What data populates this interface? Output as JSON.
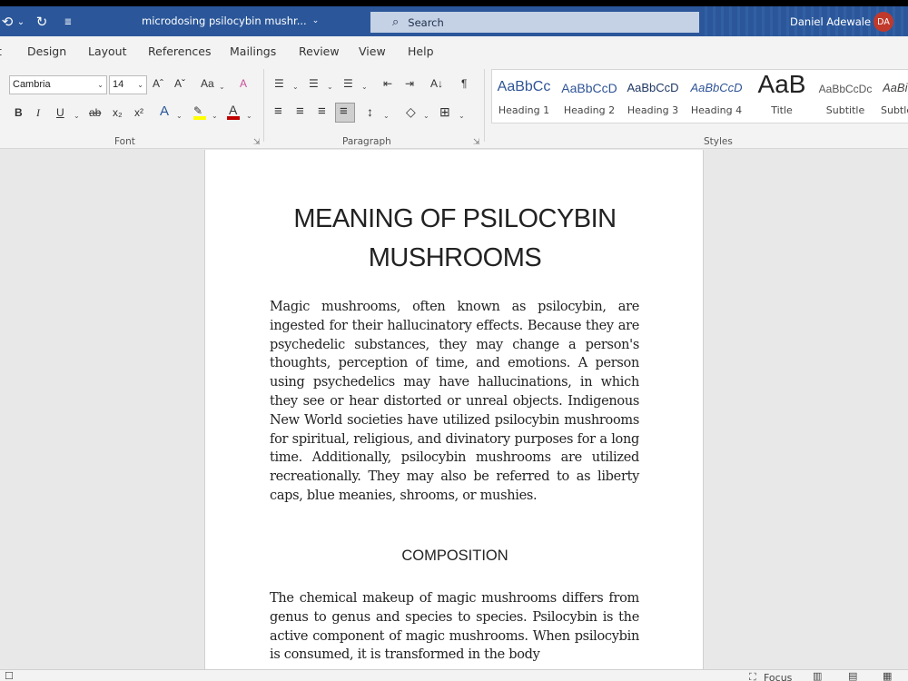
{
  "titlebar": {
    "qat": {
      "undo_icon": "⟲",
      "undo_caret": "⌄",
      "redo_icon": "↻",
      "customize_icon": "≣"
    },
    "doc_name": "microdosing psilocybin mushr...",
    "doc_caret": "⌄",
    "search": {
      "icon": "⌕",
      "label": "Search"
    },
    "user": "Daniel Adewale",
    "initials": "DA",
    "colors": {
      "bar": "#2b579a",
      "avatar": "#c0392b"
    }
  },
  "menu": {
    "partial": "t",
    "tabs": [
      "Design",
      "Layout",
      "References",
      "Mailings",
      "Review",
      "View",
      "Help"
    ]
  },
  "ribbon": {
    "font": {
      "name": "Cambria",
      "size": "14",
      "grow": "Aˆ",
      "shrink": "Aˇ",
      "case": "Aa",
      "clear": "A",
      "bold": "B",
      "italic": "I",
      "underline": "U",
      "strike": "ab",
      "subscript": "x₂",
      "superscript": "x²",
      "effects": "A",
      "highlight": "✎",
      "color": "A",
      "caret": "⌄",
      "label": "Font",
      "launcher": "⇲"
    },
    "paragraph": {
      "bullets": "☰",
      "numbering": "☰",
      "multilevel": "☰",
      "decrease_indent": "⇤",
      "increase_indent": "⇥",
      "sort": "A↓",
      "pilcrow": "¶",
      "align_left": "≡",
      "align_center": "≡",
      "align_right": "≡",
      "justify": "≡",
      "line_spacing": "↕",
      "shading": "◇",
      "borders": "⊞",
      "caret": "⌄",
      "label": "Paragraph",
      "launcher": "⇲"
    },
    "styles": {
      "label": "Styles",
      "items": [
        {
          "sample": "AaBbCc",
          "name": "Heading 1"
        },
        {
          "sample": "AaBbCcD",
          "name": "Heading 2"
        },
        {
          "sample": "AaBbCcD",
          "name": "Heading 3"
        },
        {
          "sample": "AaBbCcD",
          "name": "Heading 4"
        },
        {
          "sample": "AaB",
          "name": "Title"
        },
        {
          "sample": "AaBbCcDc",
          "name": "Subtitle"
        },
        {
          "sample": "AaBi",
          "name": "Subtle"
        }
      ]
    }
  },
  "document": {
    "heading_line1": "MEANING OF PSILOCYBIN",
    "heading_line2": "MUSHROOMS",
    "paragraph1": "Magic mushrooms, often known as psilocybin, are ingested for their hallucinatory effects. Because they are psychedelic substances, they may change a person's thoughts, perception of time, and emotions. A person using psychedelics may have hallucinations, in which they see or hear distorted or unreal objects. Indigenous New World societies have utilized psilocybin mushrooms for spiritual, religious, and divinatory purposes for a long time. Additionally, psilocybin mushrooms are utilized recreationally. They may also be referred to as liberty caps, blue meanies, shrooms, or mushies.",
    "subheading": "COMPOSITION",
    "paragraph2": "The chemical makeup of magic mushrooms differs from genus to genus and species to species. Psilocybin is the active component of magic mushrooms. When psilocybin is consumed, it is transformed in the body"
  },
  "status": {
    "page_icon": "☐",
    "focus_icon": "⛶",
    "focus": "Focus",
    "view_read": "▥",
    "view_print": "▤",
    "view_web": "▦"
  }
}
